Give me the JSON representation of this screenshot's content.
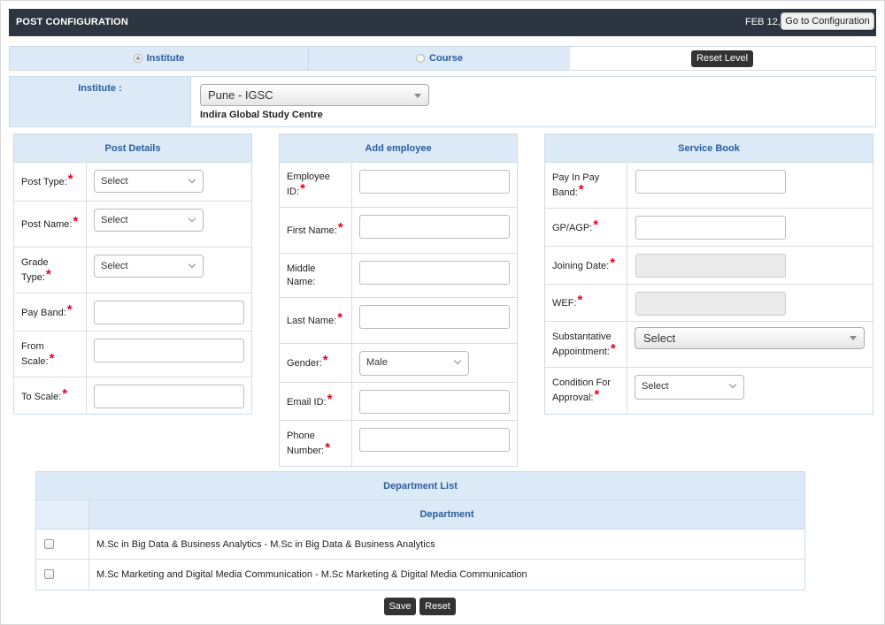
{
  "header": {
    "title": "POST CONFIGURATION",
    "date": "FEB 12,",
    "goto_label": "Go to Configuration"
  },
  "level": {
    "institute_label": "Institute",
    "course_label": "Course",
    "selected": "Institute",
    "reset_label": "Reset Level"
  },
  "institute": {
    "label": "Institute :",
    "selected": "Pune - IGSC",
    "name": "Indira Global Study Centre"
  },
  "post_details": {
    "title": "Post Details",
    "fields": [
      {
        "label": "Post Type:",
        "type": "select",
        "value": "Select"
      },
      {
        "label": "Post Name:",
        "type": "select",
        "value": "Select"
      },
      {
        "label": "Grade Type:",
        "type": "select",
        "value": "Select"
      },
      {
        "label": "Pay Band:",
        "type": "input",
        "value": ""
      },
      {
        "label": "From Scale:",
        "type": "input",
        "value": ""
      },
      {
        "label": "To Scale:",
        "type": "input",
        "value": ""
      }
    ]
  },
  "add_employee": {
    "title": "Add employee",
    "fields": [
      {
        "label": "Employee ID:",
        "required": true,
        "value": ""
      },
      {
        "label": "First Name:",
        "required": true,
        "value": ""
      },
      {
        "label": "Middle Name:",
        "required": false,
        "value": ""
      },
      {
        "label": "Last Name:",
        "required": true,
        "value": ""
      },
      {
        "label": "Gender:",
        "required": true,
        "value": "Male"
      },
      {
        "label": "Email ID:",
        "required": true,
        "value": ""
      },
      {
        "label": "Phone Number:",
        "required": true,
        "value": ""
      }
    ]
  },
  "service_book": {
    "title": "Service Book",
    "fields": [
      {
        "label": "Pay In Pay Band:",
        "value": ""
      },
      {
        "label": "GP/AGP:",
        "value": ""
      },
      {
        "label": "Joining Date:",
        "value": ""
      },
      {
        "label": "WEF:",
        "value": ""
      },
      {
        "label": "Substantative Appointment:",
        "value": "Select"
      },
      {
        "label": "Condition For Approval:",
        "value": "Select"
      }
    ]
  },
  "department_list": {
    "title": "Department List",
    "column": "Department",
    "rows": [
      "M.Sc in Big Data & Business Analytics - M.Sc in Big Data & Business Analytics",
      "M.Sc Marketing and Digital Media Communication - M.Sc Marketing & Digital Media Communication"
    ]
  },
  "actions": {
    "save_label": "Save",
    "reset_label": "Reset"
  },
  "colors": {
    "header_bg": "#2d3540",
    "panel_header_bg": "#dce9f7",
    "panel_header_text": "#2a5d9f",
    "required": "#e8001c"
  }
}
